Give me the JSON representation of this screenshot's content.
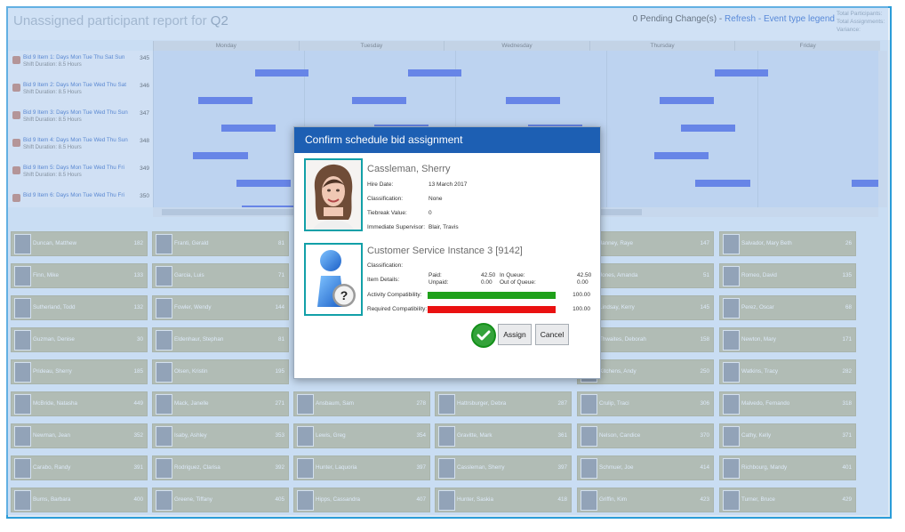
{
  "header": {
    "title_prefix": "Unassigned participant report for",
    "title_period": "Q2",
    "pending": "0 Pending Change(s) -",
    "refresh": "Refresh -",
    "legend": "Event type legend",
    "meta_1": "Total Participants:",
    "meta_2": "Total Assignments:",
    "meta_3": "Variance:"
  },
  "days": [
    "Monday",
    "Tuesday",
    "Wednesday",
    "Thursday",
    "Friday"
  ],
  "bids": [
    {
      "name": "Bid 9 Item 1: Days Mon Tue Thu Sat Sun",
      "duration": "Shift Duration: 8.5 Hours",
      "number": "345"
    },
    {
      "name": "Bid 9 Item 2: Days Mon Tue Wed Thu Sat",
      "duration": "Shift Duration: 8.5 Hours",
      "number": "346"
    },
    {
      "name": "Bid 9 Item 3: Days Mon Tue Wed Thu Sun",
      "duration": "Shift Duration: 8.5 Hours",
      "number": "347"
    },
    {
      "name": "Bid 9 Item 4: Days Mon Tue Wed Thu Sun",
      "duration": "Shift Duration: 8.5 Hours",
      "number": "348"
    },
    {
      "name": "Bid 9 Item 5: Days Mon Tue Wed Thu Fri",
      "duration": "Shift Duration: 8.5 Hours",
      "number": "349"
    },
    {
      "name": "Bid 9 Item 6: Days Mon Tue Wed Thu Fri",
      "duration": "",
      "number": "350"
    }
  ],
  "cards": [
    [
      {
        "name": "Duncan, Matthew",
        "value": "182"
      },
      {
        "name": "Franti, Gerald",
        "value": "81"
      },
      {
        "name": "",
        "value": ""
      },
      {
        "name": "",
        "value": ""
      },
      {
        "name": "Janney, Raye",
        "value": "147"
      },
      {
        "name": "Salvador, Mary Beth",
        "value": "26"
      }
    ],
    [
      {
        "name": "Finn, Mike",
        "value": "133"
      },
      {
        "name": "Garcia, Luis",
        "value": "71"
      },
      {
        "name": "",
        "value": ""
      },
      {
        "name": "",
        "value": ""
      },
      {
        "name": "Jones, Amanda",
        "value": "51"
      },
      {
        "name": "Romeo, David",
        "value": "135"
      }
    ],
    [
      {
        "name": "Sutherland, Todd",
        "value": "132"
      },
      {
        "name": "Fowler, Wendy",
        "value": "144"
      },
      {
        "name": "",
        "value": ""
      },
      {
        "name": "",
        "value": ""
      },
      {
        "name": "Lindsay, Kerry",
        "value": "145"
      },
      {
        "name": "Perez, Oscar",
        "value": "68"
      }
    ],
    [
      {
        "name": "Guzman, Denise",
        "value": "30"
      },
      {
        "name": "Eldenhaur, Stephan",
        "value": "81"
      },
      {
        "name": "",
        "value": ""
      },
      {
        "name": "",
        "value": ""
      },
      {
        "name": "Thwaites, Deborah",
        "value": "158"
      },
      {
        "name": "Newton, Mary",
        "value": "171"
      }
    ],
    [
      {
        "name": "Prideau, Sherry",
        "value": "185"
      },
      {
        "name": "Olsen, Kristin",
        "value": "195"
      },
      {
        "name": "",
        "value": ""
      },
      {
        "name": "",
        "value": ""
      },
      {
        "name": "Kitchens, Andy",
        "value": "250"
      },
      {
        "name": "Watkins, Tracy",
        "value": "282"
      }
    ],
    [
      {
        "name": "McBride, Natasha",
        "value": "449"
      },
      {
        "name": "Mack, Janelle",
        "value": "271"
      },
      {
        "name": "Ansbaum, Sam",
        "value": "278"
      },
      {
        "name": "Hattrsburger, Debra",
        "value": "287"
      },
      {
        "name": "Crulip, Traci",
        "value": "306"
      },
      {
        "name": "Malvedo, Fernando",
        "value": "318"
      }
    ],
    [
      {
        "name": "Newman, Jean",
        "value": "352"
      },
      {
        "name": "Isaby, Ashley",
        "value": "353"
      },
      {
        "name": "Lewis, Greg",
        "value": "354"
      },
      {
        "name": "Gravitte, Mark",
        "value": "361"
      },
      {
        "name": "Nelson, Candice",
        "value": "370"
      },
      {
        "name": "Cathy, Kelly",
        "value": "371"
      }
    ],
    [
      {
        "name": "Carabo, Randy",
        "value": "391"
      },
      {
        "name": "Rodriguez, Clarisa",
        "value": "392"
      },
      {
        "name": "Hunter, Laquoria",
        "value": "397"
      },
      {
        "name": "Cassleman, Sherry",
        "value": "397"
      },
      {
        "name": "Schmuer, Joe",
        "value": "414"
      },
      {
        "name": "Richbourg, Mandy",
        "value": "401"
      }
    ],
    [
      {
        "name": "Burns, Barbara",
        "value": "400"
      },
      {
        "name": "Greene, Tiffany",
        "value": "405"
      },
      {
        "name": "Hipps, Cassandra",
        "value": "407"
      },
      {
        "name": "Hunter, Saskia",
        "value": "418"
      },
      {
        "name": "Griffin, Kim",
        "value": "423"
      },
      {
        "name": "Turner, Bruce",
        "value": "429"
      }
    ]
  ],
  "dialog": {
    "title": "Confirm schedule bid assignment",
    "participant": "Cassleman, Sherry",
    "hire_label": "Hire Date:",
    "hire_value": "13 March 2017",
    "class_label": "Classification:",
    "class_value": "None",
    "tie_label": "Tiebreak Value:",
    "tie_value": "0",
    "sup_label": "Immediate Supervisor:",
    "sup_value": "Blair, Travis",
    "queue": "Customer Service Instance 3 [9142]",
    "queue_class_label": "Classification:",
    "item_label": "Item Details:",
    "paid_label": "Paid:",
    "paid_value": "42.50",
    "unpaid_label": "Unpaid:",
    "unpaid_value": "0.00",
    "inq_label": "In Queue:",
    "inq_value": "42.50",
    "outq_label": "Out of Queue:",
    "outq_value": "0.00",
    "act_label": "Activity Compatibility:",
    "act_value": "100.00",
    "req_label": "Required Compatibility:",
    "req_value": "100.00",
    "assign": "Assign",
    "cancel": "Cancel",
    "act_color": "#1fa01a",
    "req_color": "#ea1111"
  }
}
